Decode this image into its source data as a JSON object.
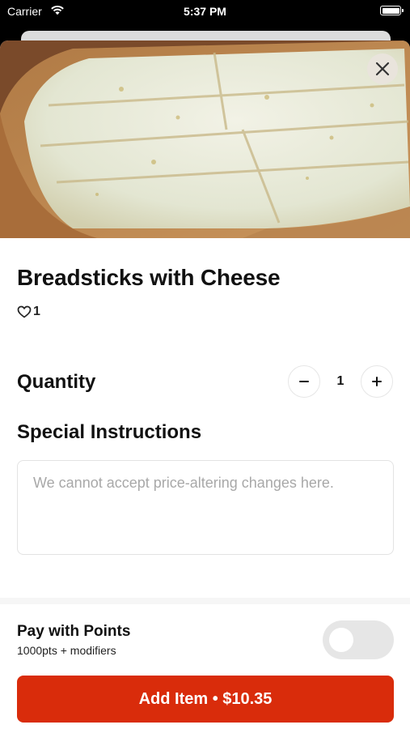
{
  "status_bar": {
    "carrier": "Carrier",
    "time": "5:37 PM"
  },
  "item": {
    "title": "Breadsticks with Cheese",
    "likes": "1"
  },
  "quantity": {
    "label": "Quantity",
    "value": "1"
  },
  "instructions": {
    "label": "Special Instructions",
    "placeholder": "We cannot accept price-altering changes here."
  },
  "points": {
    "title": "Pay with Points",
    "subtitle": "1000pts + modifiers",
    "enabled": false
  },
  "add_button": {
    "label": "Add Item • $10.35"
  },
  "colors": {
    "accent": "#d92c0b",
    "toggle_off": "#e6e6e6"
  },
  "icons": [
    "wifi-icon",
    "battery-icon",
    "close-icon",
    "heart-icon",
    "minus-icon",
    "plus-icon"
  ]
}
